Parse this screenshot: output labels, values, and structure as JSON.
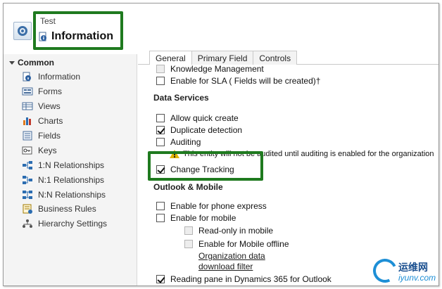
{
  "header": {
    "entity_name": "Test",
    "page_title": "Information"
  },
  "nav": {
    "section": "Common",
    "items": [
      {
        "label": "Information",
        "icon": "info-icon"
      },
      {
        "label": "Forms",
        "icon": "forms-icon"
      },
      {
        "label": "Views",
        "icon": "views-icon"
      },
      {
        "label": "Charts",
        "icon": "charts-icon"
      },
      {
        "label": "Fields",
        "icon": "fields-icon"
      },
      {
        "label": "Keys",
        "icon": "keys-icon"
      },
      {
        "label": "1:N Relationships",
        "icon": "one-to-many-icon"
      },
      {
        "label": "N:1 Relationships",
        "icon": "many-to-one-icon"
      },
      {
        "label": "N:N Relationships",
        "icon": "many-to-many-icon"
      },
      {
        "label": "Business Rules",
        "icon": "business-rules-icon"
      },
      {
        "label": "Hierarchy Settings",
        "icon": "hierarchy-icon"
      }
    ]
  },
  "tabs": [
    {
      "label": "General",
      "active": true
    },
    {
      "label": "Primary Field",
      "active": false
    },
    {
      "label": "Controls",
      "active": false
    }
  ],
  "options": {
    "knowledge_management": {
      "label": "Knowledge Management",
      "checked": false,
      "disabled": true
    },
    "enable_sla": {
      "label": "Enable for SLA ( Fields will be created)†",
      "checked": false
    },
    "data_services_title": "Data Services",
    "allow_quick_create": {
      "label": "Allow quick create",
      "checked": false
    },
    "duplicate_detection": {
      "label": "Duplicate detection",
      "checked": true
    },
    "auditing": {
      "label": "Auditing",
      "checked": false
    },
    "auditing_warning": "This entity will not be audited until auditing is enabled for the organization",
    "change_tracking": {
      "label": "Change Tracking",
      "checked": true
    },
    "outlook_title": "Outlook & Mobile",
    "phone_express": {
      "label": "Enable for phone express",
      "checked": false
    },
    "mobile": {
      "label": "Enable for mobile",
      "checked": false
    },
    "read_only_mobile": {
      "label": "Read-only in mobile",
      "checked": false,
      "disabled": true
    },
    "mobile_offline": {
      "label": "Enable for Mobile offline",
      "checked": false,
      "disabled": true
    },
    "org_data_link_1": "Organization data",
    "org_data_link_2": "download filter",
    "reading_pane": {
      "label": "Reading pane in Dynamics 365 for Outlook",
      "checked": true
    }
  },
  "watermark": {
    "top": "运维网",
    "bottom": "iyunv.com"
  },
  "colors": {
    "highlight": "#1f7a1f",
    "nav_bg": "#f4f4f4",
    "warning": "#e3b400"
  }
}
